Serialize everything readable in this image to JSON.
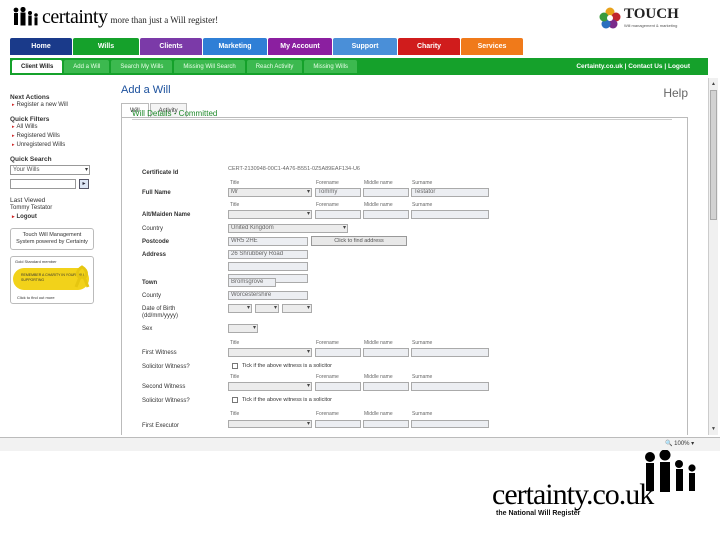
{
  "header": {
    "logo_word": "certainty",
    "tagline": "more than just a Will register!",
    "touch_word": "TOUCH",
    "touch_sub": "Will management & marketing"
  },
  "tabs": [
    {
      "label": "Home",
      "color": "#1a3a8a"
    },
    {
      "label": "Wills",
      "color": "#15a12b"
    },
    {
      "label": "Clients",
      "color": "#7b3aa8"
    },
    {
      "label": "Marketing",
      "color": "#2f7fd6"
    },
    {
      "label": "My Account",
      "color": "#8b1fa0"
    },
    {
      "label": "Support",
      "color": "#4a8fd8"
    },
    {
      "label": "Charity",
      "color": "#d01c1c"
    },
    {
      "label": "Services",
      "color": "#f07a1a"
    }
  ],
  "subtabs": [
    "Client Wills",
    "Add a Will",
    "Search My Wills",
    "Missing Will Search",
    "Reach Activity",
    "Missing Wills"
  ],
  "subnav_right": "Certainty.co.uk | Contact Us | Logout",
  "sidebar": {
    "next_actions": "Next Actions",
    "register_new": "Register a new Will",
    "quick_filters": "Quick Filters",
    "filters": [
      "All Wills",
      "Registered Wills",
      "Unregistered Wills"
    ],
    "quick_search": "Quick Search",
    "search_select": "Your Wills",
    "go": "▸",
    "last_viewed": "Last Viewed",
    "last_viewed_name": "Tommy Testator",
    "logout": "Logout",
    "powered": "Touch Will Management System powered by Certainty",
    "badge_top": "Gold Standard member",
    "badge_text": "REMEMBER A CHARITY IN YOUR WILL SUPPORTING",
    "badge_bottom": "Click to find out more"
  },
  "content": {
    "title": "Add a Will",
    "help": "Help",
    "tabs": [
      "Will",
      "Activity"
    ],
    "section": "Will Details - Committed",
    "cert_label": "Certificate Id",
    "cert_value": "CERT-2130948-00C1-4A76-B551-0Z5A89EAF134-U6",
    "name_caps": [
      "Title",
      "Forename",
      "Middle name",
      "Surname"
    ],
    "full_name_label": "Full Name",
    "full_name_values": [
      "Mr",
      "Tommy",
      "",
      "Testator"
    ],
    "maiden_label": "Alt/Maiden Name",
    "country_label": "Country",
    "country_value": "United Kingdom",
    "postcode_label": "Postcode",
    "postcode_value": "WR5 2HE",
    "postcode_btn": "Click to find address",
    "address_label": "Address",
    "address_value": "26 Shrubbery Road",
    "town_label": "Town",
    "town_value": "Bromsgrove",
    "county_label": "County",
    "county_value": "Worcestershire",
    "dob_label": "Date of Birth (dd/mm/yyyy)",
    "sex_label": "Sex",
    "first_witness_label": "First Witness",
    "solicitor1_label": "Solicitor Witness?",
    "solicitor_check": "Tick if the above witness is a solicitor",
    "second_witness_label": "Second Witness",
    "solicitor2_label": "Solicitor Witness?",
    "first_executor_label": "First Executor"
  },
  "status": {
    "zoom": "100%"
  },
  "brand": {
    "word": "certainty.co.uk",
    "tag": "the National Will Register"
  }
}
